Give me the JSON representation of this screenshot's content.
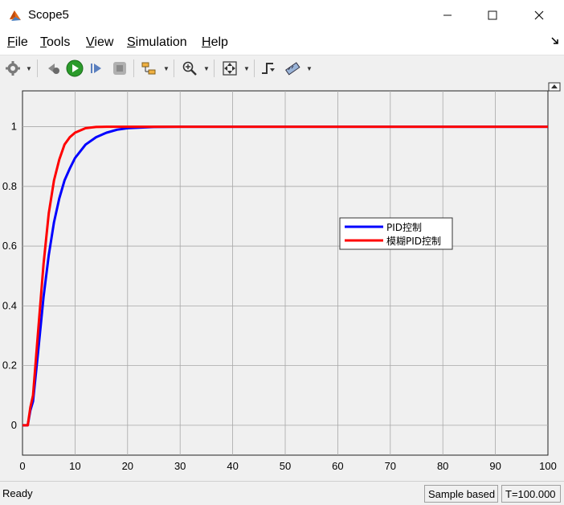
{
  "window": {
    "title": "Scope5",
    "minimize_glyph": "—",
    "maximize_glyph": "☐",
    "close_glyph": "✕"
  },
  "menu": {
    "items": [
      {
        "label": "File"
      },
      {
        "label": "Tools"
      },
      {
        "label": "View"
      },
      {
        "label": "Simulation"
      },
      {
        "label": "Help"
      }
    ]
  },
  "toolbar": {
    "icons": [
      "gear-icon",
      "step-back-icon",
      "run-icon",
      "step-forward-icon",
      "stop-icon",
      "signal-selector-icon",
      "zoom-icon",
      "fit-to-view-icon",
      "triggers-icon",
      "cursor-measurements-icon"
    ]
  },
  "status": {
    "ready": "Ready",
    "mode": "Sample based",
    "time": "T=100.000"
  },
  "chart_data": {
    "type": "line",
    "title": "",
    "xlabel": "",
    "ylabel": "",
    "xlim": [
      0,
      100
    ],
    "ylim": [
      -0.1,
      1.12
    ],
    "x_ticks": [
      0,
      10,
      20,
      30,
      40,
      50,
      60,
      70,
      80,
      90,
      100
    ],
    "y_ticks": [
      0,
      0.2,
      0.4,
      0.6,
      0.8,
      1
    ],
    "y_tick_labels": [
      "0",
      "0.2",
      "0.4",
      "0.6",
      "0.8",
      "1"
    ],
    "grid": true,
    "legend_position": "center-right",
    "series": [
      {
        "name": "PID控制",
        "color": "#0000ff",
        "x": [
          0,
          1,
          1.5,
          2,
          3,
          4,
          5,
          6,
          7,
          8,
          9,
          10,
          12,
          14,
          16,
          18,
          20,
          25,
          30,
          40,
          100
        ],
        "y": [
          0,
          0,
          0.05,
          0.08,
          0.25,
          0.43,
          0.57,
          0.68,
          0.76,
          0.82,
          0.86,
          0.895,
          0.94,
          0.965,
          0.98,
          0.99,
          0.995,
          0.999,
          1.0,
          1.0,
          1.0
        ]
      },
      {
        "name": "模糊PID控制",
        "color": "#ff0000",
        "x": [
          0,
          1,
          1.5,
          2,
          3,
          4,
          5,
          6,
          7,
          8,
          9,
          10,
          12,
          14,
          16,
          18,
          20,
          30,
          100
        ],
        "y": [
          0,
          0,
          0.06,
          0.1,
          0.32,
          0.54,
          0.71,
          0.82,
          0.89,
          0.94,
          0.965,
          0.98,
          0.995,
          0.999,
          1.0,
          1.0,
          1.0,
          1.0,
          1.0
        ]
      }
    ]
  }
}
